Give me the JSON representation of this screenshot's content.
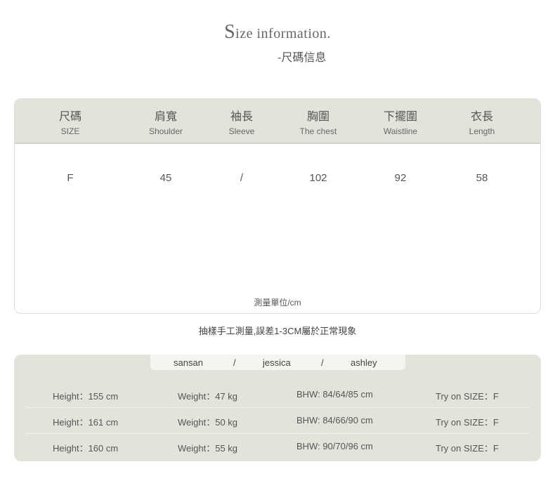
{
  "header": {
    "title_initial": "S",
    "title_rest": "ize information.",
    "subtitle": "-尺碼信息"
  },
  "size_table": {
    "columns": [
      {
        "zh": "尺碼",
        "en": "SIZE"
      },
      {
        "zh": "肩寬",
        "en": "Shoulder"
      },
      {
        "zh": "袖長",
        "en": "Sleeve"
      },
      {
        "zh": "胸圍",
        "en": "The chest"
      },
      {
        "zh": "下擺圍",
        "en": "Waistline"
      },
      {
        "zh": "衣長",
        "en": "Length"
      }
    ],
    "rows": [
      [
        "F",
        "45",
        "/",
        "102",
        "92",
        "58"
      ]
    ],
    "unit": "測量單位/cm"
  },
  "note": "抽樣手工測量,誤差1-3CM屬於正常現象",
  "models": {
    "names": [
      "sansan",
      "/",
      "jessica",
      "/",
      "ashley"
    ],
    "rows": [
      {
        "height": "Height：155 cm",
        "weight": "Weight：47 kg",
        "bhw": "BHW: 84/64/85 cm",
        "try": "Try on SIZE：F"
      },
      {
        "height": "Height：161 cm",
        "weight": "Weight：50 kg",
        "bhw": "BHW: 84/66/90 cm",
        "try": "Try on SIZE：F"
      },
      {
        "height": "Height：160 cm",
        "weight": "Weight：55 kg",
        "bhw": "BHW: 90/70/96 cm",
        "try": "Try on SIZE：F"
      }
    ]
  }
}
